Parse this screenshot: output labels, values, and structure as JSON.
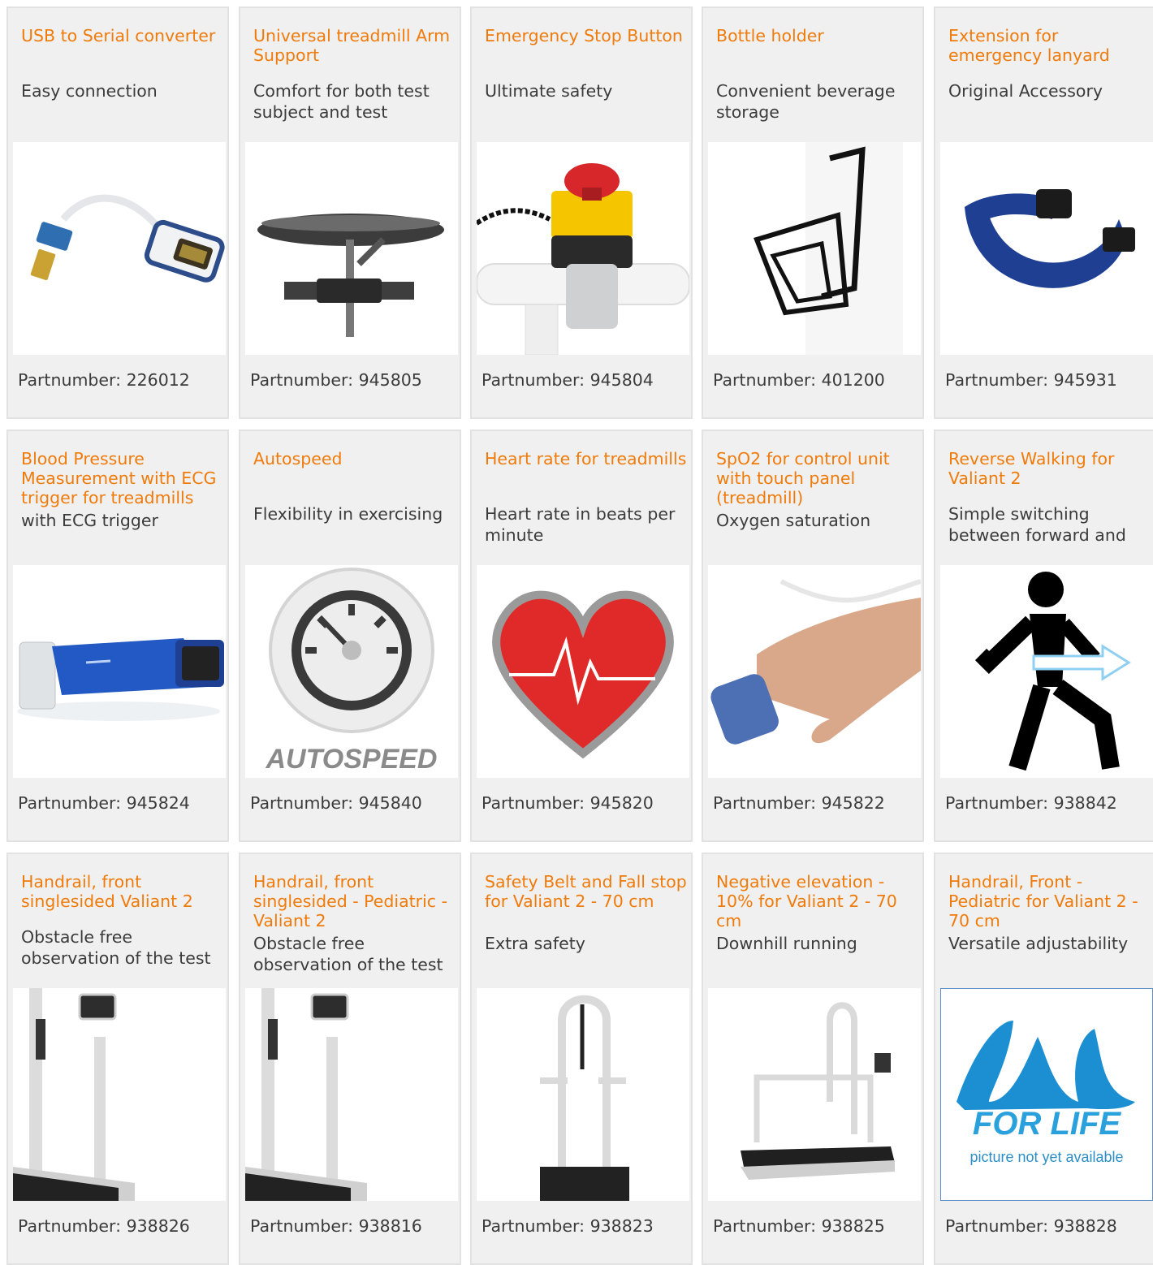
{
  "colors": {
    "title": "#f07b0a",
    "text": "#3b3b3b",
    "card_bg": "#f0f0f0",
    "card_border": "#e2e2e2",
    "lode_blue": "#1b8fd1"
  },
  "part_label": "Partnumber:",
  "products": [
    {
      "title": "USB to Serial converter",
      "subtitle": "Easy connection",
      "part_number": "226012",
      "icon": "usb-serial-cable-icon"
    },
    {
      "title": "Universal treadmill Arm Support",
      "subtitle": "Comfort for both test subject and test",
      "part_number": "945805",
      "icon": "arm-support-icon"
    },
    {
      "title": "Emergency Stop Button",
      "subtitle": "Ultimate safety",
      "part_number": "945804",
      "icon": "emergency-stop-icon"
    },
    {
      "title": "Bottle holder",
      "subtitle": "Convenient beverage storage",
      "part_number": "401200",
      "icon": "bottle-holder-icon"
    },
    {
      "title": "Extension for emergency lanyard",
      "subtitle": "Original Accessory",
      "part_number": "945931",
      "icon": "lanyard-strap-icon"
    },
    {
      "title": "Blood Pressure Measurement with ECG trigger for treadmills",
      "subtitle": "with ECG trigger",
      "part_number": "945824",
      "icon": "blood-pressure-cuff-icon"
    },
    {
      "title": "Autospeed",
      "subtitle": "Flexibility in exercising",
      "part_number": "945840",
      "icon": "speedometer-icon",
      "image_text": "AUTOSPEED"
    },
    {
      "title": "Heart rate for treadmills",
      "subtitle": "Heart rate in beats per minute",
      "part_number": "945820",
      "icon": "heart-ecg-icon"
    },
    {
      "title": "SpO2 for control unit with touch panel (treadmill)",
      "subtitle": "Oxygen saturation",
      "part_number": "945822",
      "icon": "finger-sensor-icon"
    },
    {
      "title": "Reverse Walking for Valiant 2",
      "subtitle": "Simple switching between forward and",
      "part_number": "938842",
      "icon": "walking-person-icon"
    },
    {
      "title": "Handrail, front singlesided Valiant 2",
      "subtitle": "Obstacle free observation of the test",
      "part_number": "938826",
      "icon": "treadmill-handrail-icon"
    },
    {
      "title": "Handrail, front singlesided - Pediatric - Valiant 2",
      "subtitle": "Obstacle free observation of the test",
      "part_number": "938816",
      "icon": "treadmill-handrail-icon"
    },
    {
      "title": "Safety Belt and Fall stop for Valiant 2 - 70 cm",
      "subtitle": "Extra safety",
      "part_number": "938823",
      "icon": "treadmill-arch-icon"
    },
    {
      "title": "Negative elevation - 10% for Valiant 2 - 70 cm",
      "subtitle": "Downhill running",
      "part_number": "938825",
      "icon": "treadmill-full-icon"
    },
    {
      "title": "Handrail, Front - Pediatric for Valiant 2 - 70 cm",
      "subtitle": "Versatile adjustability",
      "part_number": "938828",
      "icon": "lode-logo-placeholder-icon",
      "image_text_1": "FOR LIFE",
      "image_text_2": "picture not yet available"
    }
  ]
}
